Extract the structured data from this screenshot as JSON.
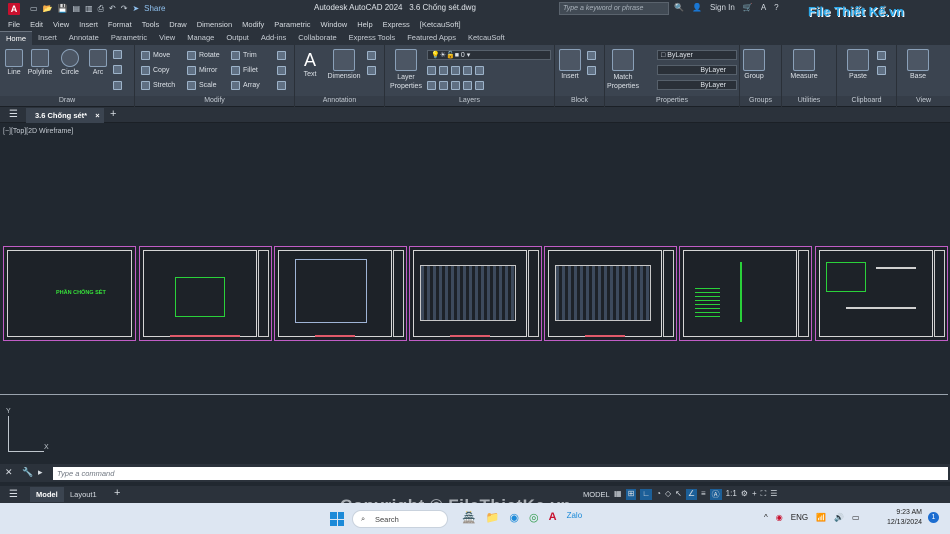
{
  "titlebar": {
    "app": "Autodesk AutoCAD 2024",
    "file": "3.6 Chống sét.dwg",
    "share": "Share",
    "search_placeholder": "Type a keyword or phrase",
    "sign_in": "Sign In"
  },
  "menu": [
    "File",
    "Edit",
    "View",
    "Insert",
    "Format",
    "Tools",
    "Draw",
    "Dimension",
    "Modify",
    "Parametric",
    "Window",
    "Help",
    "Express",
    "[KetcauSoft]"
  ],
  "ribbon_tabs": [
    "Home",
    "Insert",
    "Annotate",
    "Parametric",
    "View",
    "Manage",
    "Output",
    "Add-ins",
    "Collaborate",
    "Express Tools",
    "Featured Apps",
    "KetcauSoft"
  ],
  "draw": {
    "line": "Line",
    "polyline": "Polyline",
    "circle": "Circle",
    "arc": "Arc",
    "label": "Draw"
  },
  "modify": {
    "move": "Move",
    "rotate": "Rotate",
    "trim": "Trim",
    "copy": "Copy",
    "mirror": "Mirror",
    "fillet": "Fillet",
    "stretch": "Stretch",
    "scale": "Scale",
    "array": "Array",
    "label": "Modify"
  },
  "annotation": {
    "text": "Text",
    "dimension": "Dimension",
    "label": "Annotation"
  },
  "layers": {
    "layer_properties": "Layer\nProperties",
    "current": "0",
    "label": "Layers"
  },
  "block": {
    "insert": "Insert",
    "label": "Block"
  },
  "properties": {
    "match": "Match\nProperties",
    "color": "ByLayer",
    "linetype": "ByLayer",
    "lineweight": "ByLayer",
    "label": "Properties"
  },
  "groups": {
    "group": "Group",
    "label": "Groups"
  },
  "utilities": {
    "measure": "Measure",
    "label": "Utilities"
  },
  "clipboard": {
    "paste": "Paste",
    "label": "Clipboard"
  },
  "view": {
    "base": "Base",
    "label": "View"
  },
  "file_tab": "3.6 Chống sét*",
  "viewport_label": "[−][Top][2D Wireframe]",
  "sheet1_title": "PHẦN CHỐNG SÉT",
  "command_placeholder": "Type a command",
  "layout_tabs": [
    "Model",
    "Layout1"
  ],
  "status": {
    "model": "MODEL",
    "scale": "1:1"
  },
  "taskbar": {
    "search": "Search",
    "lang": "ENG",
    "time": "9:23 AM",
    "date": "12/13/2024",
    "notif": "1"
  },
  "watermark": "Copyright © FileThietKe.vn",
  "logo": "File Thiết Kế.vn",
  "colors": {
    "ribbon": "#3b4450",
    "sheet_border": "#c15dc6",
    "accent": "#1c8ad8"
  }
}
